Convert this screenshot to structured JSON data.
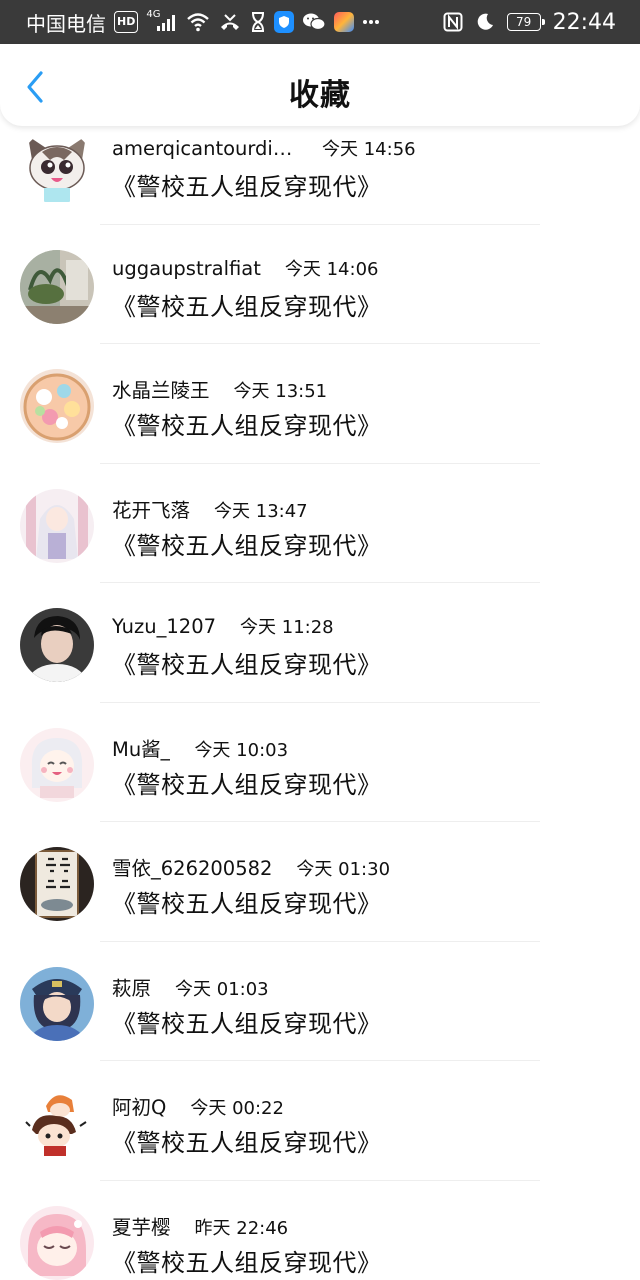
{
  "status_bar": {
    "carrier": "中国电信",
    "hd": "HD",
    "network": "4G",
    "battery": "79",
    "time": "22:44"
  },
  "header": {
    "title": "收藏",
    "back_icon": "chevron-left-icon",
    "back_color": "#2a9df4"
  },
  "items": [
    {
      "name": "amerqicantourdis…",
      "time": "今天 14:56",
      "book": "《警校五人组反穿现代》",
      "avatar": "cat-cartoon"
    },
    {
      "name": "uggaupstralfiat",
      "time": "今天 14:06",
      "book": "《警校五人组反穿现代》",
      "avatar": "photo-plants"
    },
    {
      "name": "水晶兰陵王",
      "time": "今天 13:51",
      "book": "《警校五人组反穿现代》",
      "avatar": "food-bowl"
    },
    {
      "name": "花开飞落",
      "time": "今天 13:47",
      "book": "《警校五人组反穿现代》",
      "avatar": "anime-girl-white"
    },
    {
      "name": "Yuzu_1207",
      "time": "今天 11:28",
      "book": "《警校五人组反穿现代》",
      "avatar": "person-photo"
    },
    {
      "name": "Mu酱_",
      "time": "今天 10:03",
      "book": "《警校五人组反穿现代》",
      "avatar": "anime-girl-pink"
    },
    {
      "name": "雪依_626200582",
      "time": "今天 01:30",
      "book": "《警校五人组反穿现代》",
      "avatar": "calligraphy"
    },
    {
      "name": "萩原",
      "time": "今天 01:03",
      "book": "《警校五人组反穿现代》",
      "avatar": "anime-police"
    },
    {
      "name": "阿初Q",
      "time": "今天 00:22",
      "book": "《警校五人组反穿现代》",
      "avatar": "chibi-pair"
    },
    {
      "name": "夏芋樱",
      "time": "昨天 22:46",
      "book": "《警校五人组反穿现代》",
      "avatar": "anime-girl-sleepy"
    }
  ]
}
